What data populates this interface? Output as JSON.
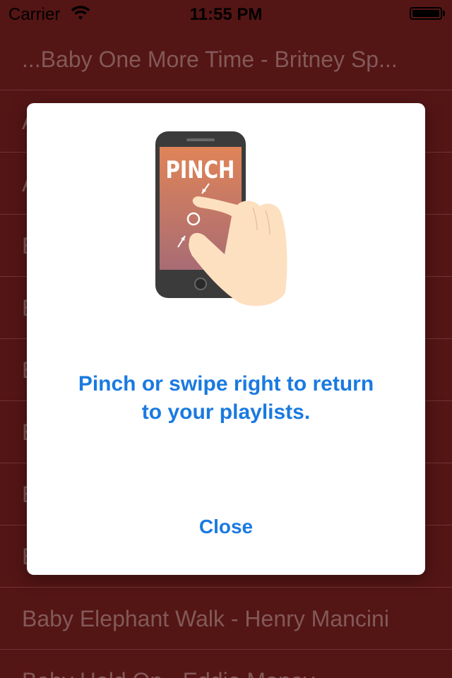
{
  "status_bar": {
    "carrier": "Carrier",
    "time": "11:55 PM"
  },
  "songs": [
    "...Baby One More Time - Britney Sp...",
    "A",
    "A",
    "B",
    "B",
    "B",
    "B",
    "B",
    "B",
    "Baby Elephant Walk - Henry Mancini",
    "Baby Hold On - Eddie Money"
  ],
  "modal": {
    "illustration_text": "PINCH",
    "message_line1": "Pinch or swipe right to return",
    "message_line2": "to your playlists.",
    "close_label": "Close"
  },
  "colors": {
    "background": "#5c1717",
    "accent": "#1a7ae0"
  }
}
